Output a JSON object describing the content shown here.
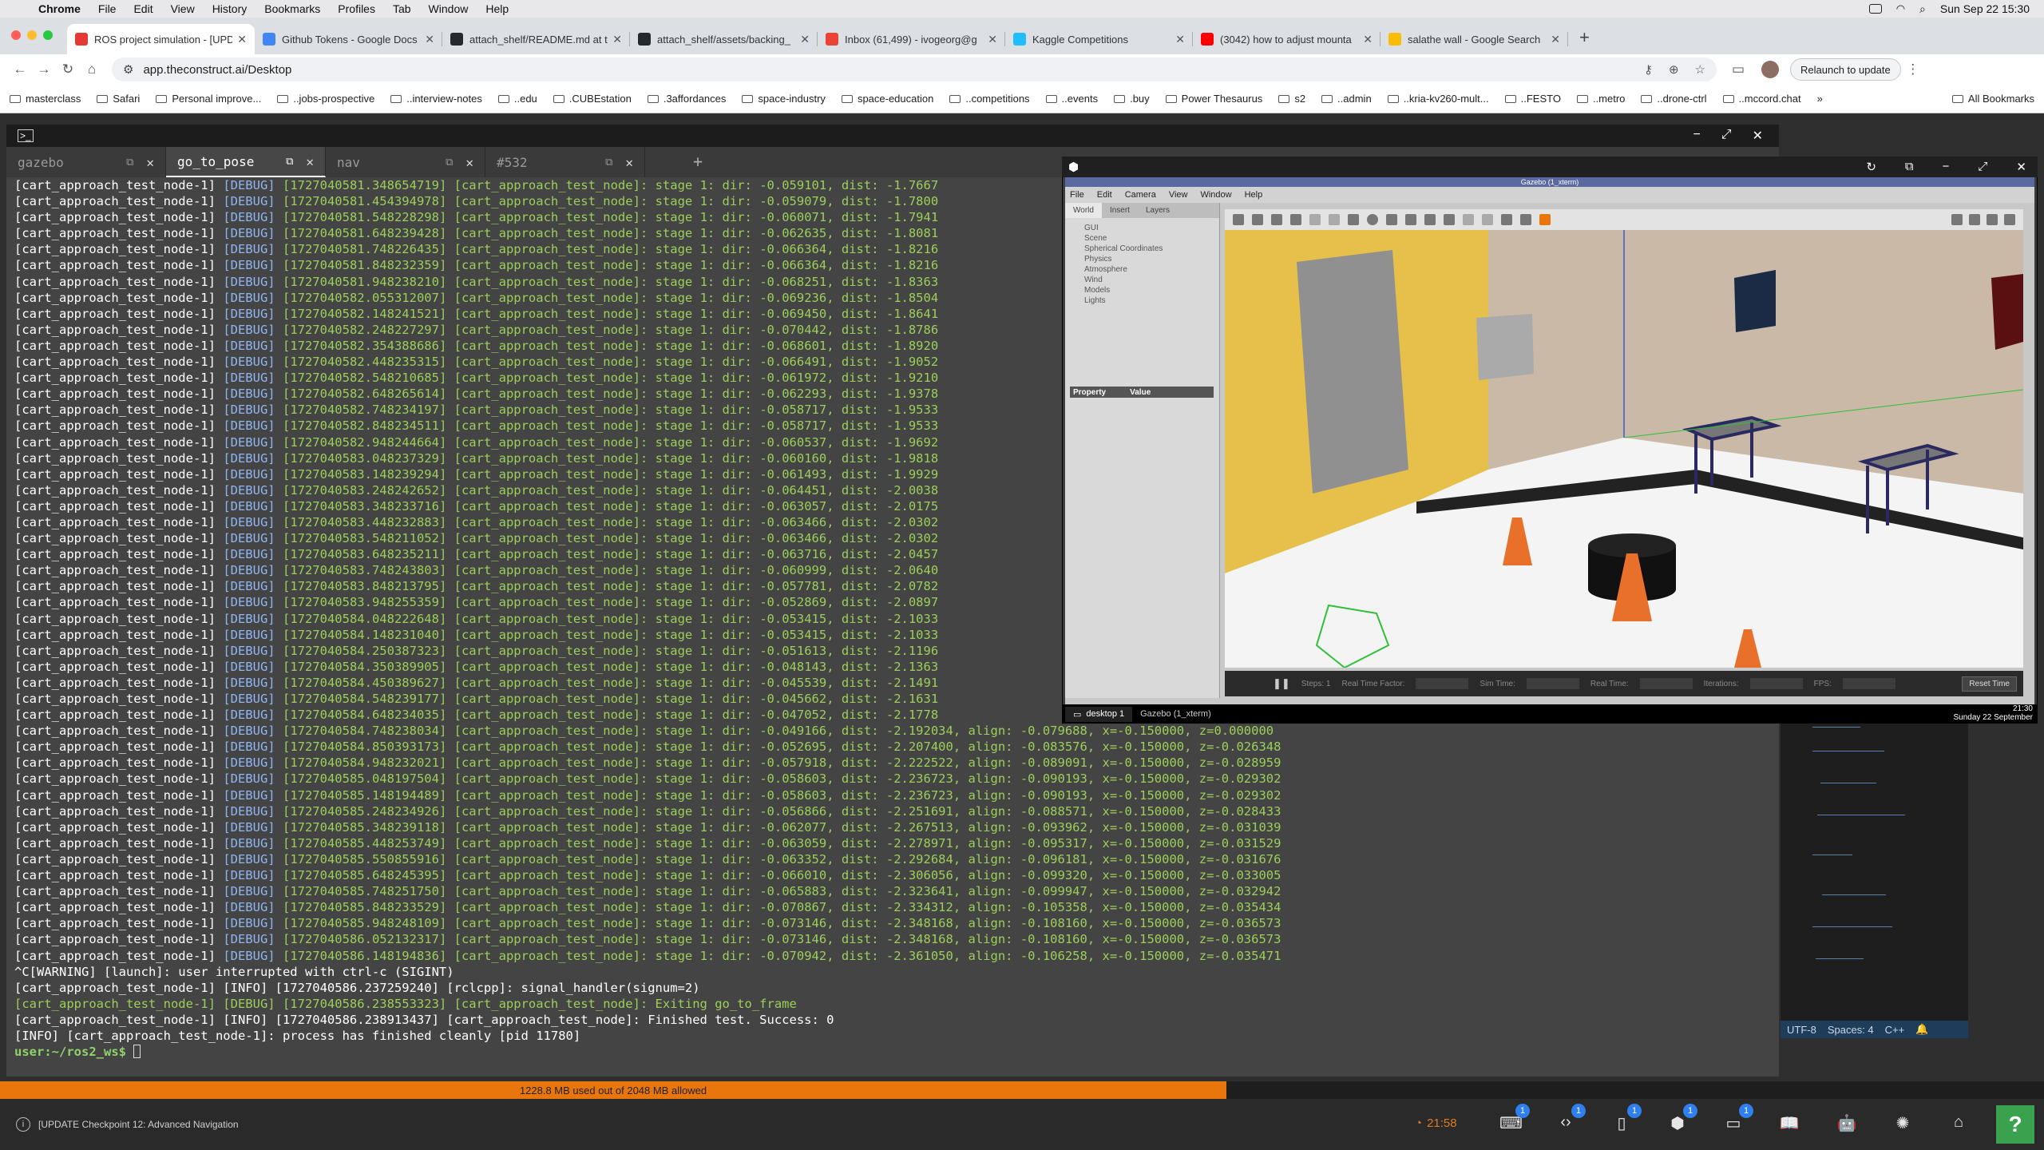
{
  "menubar": {
    "app": "Chrome",
    "items": [
      "File",
      "Edit",
      "View",
      "History",
      "Bookmarks",
      "Profiles",
      "Tab",
      "Window",
      "Help"
    ],
    "datetime": "Sun Sep 22  15:30"
  },
  "tabs": [
    {
      "title": "ROS project simulation - [UPD",
      "color": "#e53935"
    },
    {
      "title": "Github Tokens - Google Docs",
      "color": "#4285f4"
    },
    {
      "title": "attach_shelf/README.md at t",
      "color": "#24292e"
    },
    {
      "title": "attach_shelf/assets/backing_",
      "color": "#24292e"
    },
    {
      "title": "Inbox (61,499) - ivogeorg@g",
      "color": "#ea4335"
    },
    {
      "title": "Kaggle Competitions",
      "color": "#20beff"
    },
    {
      "title": "(3042) how to adjust mounta",
      "color": "#ff0000"
    },
    {
      "title": "salathe wall - Google Search",
      "color": "#fbbc05"
    }
  ],
  "address": {
    "url": "app.theconstruct.ai/Desktop",
    "relaunch": "Relaunch to update"
  },
  "bookmarks": [
    "masterclass",
    "Safari",
    "Personal improve...",
    "..jobs-prospective",
    "..interview-notes",
    "..edu",
    ".CUBEstation",
    ".3affordances",
    "space-industry",
    "space-education",
    "..competitions",
    "..events",
    ".buy",
    "Power Thesaurus",
    "s2",
    "..admin",
    "..kria-kv260-mult...",
    "..FESTO",
    "..metro",
    "..drone-ctrl",
    "..mccord.chat"
  ],
  "bookmarks_all": "All Bookmarks",
  "terminal": {
    "tabs": [
      "gazebo",
      "go_to_pose",
      "nav",
      "#532"
    ],
    "active_tab": 1,
    "lines": [
      [
        "[cart_approach_test_node-1]",
        "[DEBUG]",
        "[1727040581.348654719] [cart_approach_test_node]: stage 1: dir: -0.059101, dist: -1.7667"
      ],
      [
        "[cart_approach_test_node-1]",
        "[DEBUG]",
        "[1727040581.454394978] [cart_approach_test_node]: stage 1: dir: -0.059079, dist: -1.7800"
      ],
      [
        "[cart_approach_test_node-1]",
        "[DEBUG]",
        "[1727040581.548228298] [cart_approach_test_node]: stage 1: dir: -0.060071, dist: -1.7941"
      ],
      [
        "[cart_approach_test_node-1]",
        "[DEBUG]",
        "[1727040581.648239428] [cart_approach_test_node]: stage 1: dir: -0.062635, dist: -1.8081"
      ],
      [
        "[cart_approach_test_node-1]",
        "[DEBUG]",
        "[1727040581.748226435] [cart_approach_test_node]: stage 1: dir: -0.066364, dist: -1.8216"
      ],
      [
        "[cart_approach_test_node-1]",
        "[DEBUG]",
        "[1727040581.848232359] [cart_approach_test_node]: stage 1: dir: -0.066364, dist: -1.8216"
      ],
      [
        "[cart_approach_test_node-1]",
        "[DEBUG]",
        "[1727040581.948238210] [cart_approach_test_node]: stage 1: dir: -0.068251, dist: -1.8363"
      ],
      [
        "[cart_approach_test_node-1]",
        "[DEBUG]",
        "[1727040582.055312007] [cart_approach_test_node]: stage 1: dir: -0.069236, dist: -1.8504"
      ],
      [
        "[cart_approach_test_node-1]",
        "[DEBUG]",
        "[1727040582.148241521] [cart_approach_test_node]: stage 1: dir: -0.069450, dist: -1.8641"
      ],
      [
        "[cart_approach_test_node-1]",
        "[DEBUG]",
        "[1727040582.248227297] [cart_approach_test_node]: stage 1: dir: -0.070442, dist: -1.8786"
      ],
      [
        "[cart_approach_test_node-1]",
        "[DEBUG]",
        "[1727040582.354388686] [cart_approach_test_node]: stage 1: dir: -0.068601, dist: -1.8920"
      ],
      [
        "[cart_approach_test_node-1]",
        "[DEBUG]",
        "[1727040582.448235315] [cart_approach_test_node]: stage 1: dir: -0.066491, dist: -1.9052"
      ],
      [
        "[cart_approach_test_node-1]",
        "[DEBUG]",
        "[1727040582.548210685] [cart_approach_test_node]: stage 1: dir: -0.061972, dist: -1.9210"
      ],
      [
        "[cart_approach_test_node-1]",
        "[DEBUG]",
        "[1727040582.648265614] [cart_approach_test_node]: stage 1: dir: -0.062293, dist: -1.9378"
      ],
      [
        "[cart_approach_test_node-1]",
        "[DEBUG]",
        "[1727040582.748234197] [cart_approach_test_node]: stage 1: dir: -0.058717, dist: -1.9533"
      ],
      [
        "[cart_approach_test_node-1]",
        "[DEBUG]",
        "[1727040582.848234511] [cart_approach_test_node]: stage 1: dir: -0.058717, dist: -1.9533"
      ],
      [
        "[cart_approach_test_node-1]",
        "[DEBUG]",
        "[1727040582.948244664] [cart_approach_test_node]: stage 1: dir: -0.060537, dist: -1.9692"
      ],
      [
        "[cart_approach_test_node-1]",
        "[DEBUG]",
        "[1727040583.048237329] [cart_approach_test_node]: stage 1: dir: -0.060160, dist: -1.9818"
      ],
      [
        "[cart_approach_test_node-1]",
        "[DEBUG]",
        "[1727040583.148239294] [cart_approach_test_node]: stage 1: dir: -0.061493, dist: -1.9929"
      ],
      [
        "[cart_approach_test_node-1]",
        "[DEBUG]",
        "[1727040583.248242652] [cart_approach_test_node]: stage 1: dir: -0.064451, dist: -2.0038"
      ],
      [
        "[cart_approach_test_node-1]",
        "[DEBUG]",
        "[1727040583.348233716] [cart_approach_test_node]: stage 1: dir: -0.063057, dist: -2.0175"
      ],
      [
        "[cart_approach_test_node-1]",
        "[DEBUG]",
        "[1727040583.448232883] [cart_approach_test_node]: stage 1: dir: -0.063466, dist: -2.0302"
      ],
      [
        "[cart_approach_test_node-1]",
        "[DEBUG]",
        "[1727040583.548211052] [cart_approach_test_node]: stage 1: dir: -0.063466, dist: -2.0302"
      ],
      [
        "[cart_approach_test_node-1]",
        "[DEBUG]",
        "[1727040583.648235211] [cart_approach_test_node]: stage 1: dir: -0.063716, dist: -2.0457"
      ],
      [
        "[cart_approach_test_node-1]",
        "[DEBUG]",
        "[1727040583.748243803] [cart_approach_test_node]: stage 1: dir: -0.060999, dist: -2.0640"
      ],
      [
        "[cart_approach_test_node-1]",
        "[DEBUG]",
        "[1727040583.848213795] [cart_approach_test_node]: stage 1: dir: -0.057781, dist: -2.0782"
      ],
      [
        "[cart_approach_test_node-1]",
        "[DEBUG]",
        "[1727040583.948255359] [cart_approach_test_node]: stage 1: dir: -0.052869, dist: -2.0897"
      ],
      [
        "[cart_approach_test_node-1]",
        "[DEBUG]",
        "[1727040584.048222648] [cart_approach_test_node]: stage 1: dir: -0.053415, dist: -2.1033"
      ],
      [
        "[cart_approach_test_node-1]",
        "[DEBUG]",
        "[1727040584.148231040] [cart_approach_test_node]: stage 1: dir: -0.053415, dist: -2.1033"
      ],
      [
        "[cart_approach_test_node-1]",
        "[DEBUG]",
        "[1727040584.250387323] [cart_approach_test_node]: stage 1: dir: -0.051613, dist: -2.1196"
      ],
      [
        "[cart_approach_test_node-1]",
        "[DEBUG]",
        "[1727040584.350389905] [cart_approach_test_node]: stage 1: dir: -0.048143, dist: -2.1363"
      ],
      [
        "[cart_approach_test_node-1]",
        "[DEBUG]",
        "[1727040584.450389627] [cart_approach_test_node]: stage 1: dir: -0.045539, dist: -2.1491"
      ],
      [
        "[cart_approach_test_node-1]",
        "[DEBUG]",
        "[1727040584.548239177] [cart_approach_test_node]: stage 1: dir: -0.045662, dist: -2.1631"
      ],
      [
        "[cart_approach_test_node-1]",
        "[DEBUG]",
        "[1727040584.648234035] [cart_approach_test_node]: stage 1: dir: -0.047052, dist: -2.1778"
      ],
      [
        "[cart_approach_test_node-1]",
        "[DEBUG]",
        "[1727040584.748238034] [cart_approach_test_node]: stage 1: dir: -0.049166, dist: -2.192034, align: -0.079688, x=-0.150000, z=0.000000"
      ],
      [
        "[cart_approach_test_node-1]",
        "[DEBUG]",
        "[1727040584.850393173] [cart_approach_test_node]: stage 1: dir: -0.052695, dist: -2.207400, align: -0.083576, x=-0.150000, z=-0.026348"
      ],
      [
        "[cart_approach_test_node-1]",
        "[DEBUG]",
        "[1727040584.948232021] [cart_approach_test_node]: stage 1: dir: -0.057918, dist: -2.222522, align: -0.089091, x=-0.150000, z=-0.028959"
      ],
      [
        "[cart_approach_test_node-1]",
        "[DEBUG]",
        "[1727040585.048197504] [cart_approach_test_node]: stage 1: dir: -0.058603, dist: -2.236723, align: -0.090193, x=-0.150000, z=-0.029302"
      ],
      [
        "[cart_approach_test_node-1]",
        "[DEBUG]",
        "[1727040585.148194489] [cart_approach_test_node]: stage 1: dir: -0.058603, dist: -2.236723, align: -0.090193, x=-0.150000, z=-0.029302"
      ],
      [
        "[cart_approach_test_node-1]",
        "[DEBUG]",
        "[1727040585.248234926] [cart_approach_test_node]: stage 1: dir: -0.056866, dist: -2.251691, align: -0.088571, x=-0.150000, z=-0.028433"
      ],
      [
        "[cart_approach_test_node-1]",
        "[DEBUG]",
        "[1727040585.348239118] [cart_approach_test_node]: stage 1: dir: -0.062077, dist: -2.267513, align: -0.093962, x=-0.150000, z=-0.031039"
      ],
      [
        "[cart_approach_test_node-1]",
        "[DEBUG]",
        "[1727040585.448253749] [cart_approach_test_node]: stage 1: dir: -0.063059, dist: -2.278971, align: -0.095317, x=-0.150000, z=-0.031529"
      ],
      [
        "[cart_approach_test_node-1]",
        "[DEBUG]",
        "[1727040585.550855916] [cart_approach_test_node]: stage 1: dir: -0.063352, dist: -2.292684, align: -0.096181, x=-0.150000, z=-0.031676"
      ],
      [
        "[cart_approach_test_node-1]",
        "[DEBUG]",
        "[1727040585.648245395] [cart_approach_test_node]: stage 1: dir: -0.066010, dist: -2.306056, align: -0.099320, x=-0.150000, z=-0.033005"
      ],
      [
        "[cart_approach_test_node-1]",
        "[DEBUG]",
        "[1727040585.748251750] [cart_approach_test_node]: stage 1: dir: -0.065883, dist: -2.323641, align: -0.099947, x=-0.150000, z=-0.032942"
      ],
      [
        "[cart_approach_test_node-1]",
        "[DEBUG]",
        "[1727040585.848233529] [cart_approach_test_node]: stage 1: dir: -0.070867, dist: -2.334312, align: -0.105358, x=-0.150000, z=-0.035434"
      ],
      [
        "[cart_approach_test_node-1]",
        "[DEBUG]",
        "[1727040585.948248109] [cart_approach_test_node]: stage 1: dir: -0.073146, dist: -2.348168, align: -0.108160, x=-0.150000, z=-0.036573"
      ],
      [
        "[cart_approach_test_node-1]",
        "[DEBUG]",
        "[1727040586.052132317] [cart_approach_test_node]: stage 1: dir: -0.073146, dist: -2.348168, align: -0.108160, x=-0.150000, z=-0.036573"
      ],
      [
        "[cart_approach_test_node-1]",
        "[DEBUG]",
        "[1727040586.148194836] [cart_approach_test_node]: stage 1: dir: -0.070942, dist: -2.361050, align: -0.106258, x=-0.150000, z=-0.035471"
      ]
    ],
    "tail": [
      "^C[WARNING] [launch]: user interrupted with ctrl-c (SIGINT)",
      "[cart_approach_test_node-1] [INFO] [1727040586.237259240] [rclcpp]: signal_handler(signum=2)",
      "[cart_approach_test_node-1] [DEBUG] [1727040586.238553323] [cart_approach_test_node]: Exiting go_to_frame",
      "[cart_approach_test_node-1] [INFO] [1727040586.238913437] [cart_approach_test_node]: Finished test. Success: 0",
      "[INFO] [cart_approach_test_node-1]: process has finished cleanly [pid 11780]"
    ],
    "prompt_user": "user",
    "prompt_path": ":~/ros2_ws$ "
  },
  "gazebo": {
    "caption": "Gazebo (1_xterm)",
    "menu": [
      "File",
      "Edit",
      "Camera",
      "View",
      "Window",
      "Help"
    ],
    "left_tabs": [
      "World",
      "Insert",
      "Layers"
    ],
    "tree": [
      "GUI",
      "Scene",
      "Spherical Coordinates",
      "Physics",
      "Atmosphere",
      "Wind",
      "Models",
      "Lights"
    ],
    "prop_header": [
      "Property",
      "Value"
    ],
    "bottom": {
      "steps": "Steps: 1",
      "rtf": "Real Time Factor:",
      "sim": "Sim Time:",
      "real": "Real Time:",
      "iter": "Iterations:",
      "fps": "FPS:",
      "reset": "Reset Time"
    },
    "desktop_label": "desktop 1",
    "task_label": "Gazebo (1_xterm)",
    "clock_time": "21:30",
    "clock_date": "Sunday 22 September"
  },
  "editor_status": {
    "encoding": "UTF-8",
    "spaces": "Spaces: 4",
    "lang": "C++"
  },
  "memory": {
    "text": "1228.8 MB used out of 2048 MB allowed",
    "fraction": 0.6
  },
  "bottom": {
    "project": "[UPDATE Checkpoint 12: Advanced Navigation",
    "timer": "21:58",
    "badges": [
      "1",
      "1",
      "1",
      "1",
      "1"
    ]
  },
  "colors": {
    "orange": "#e8760c",
    "help_green": "#3aa24f",
    "prompt_green": "#8fd36a"
  }
}
